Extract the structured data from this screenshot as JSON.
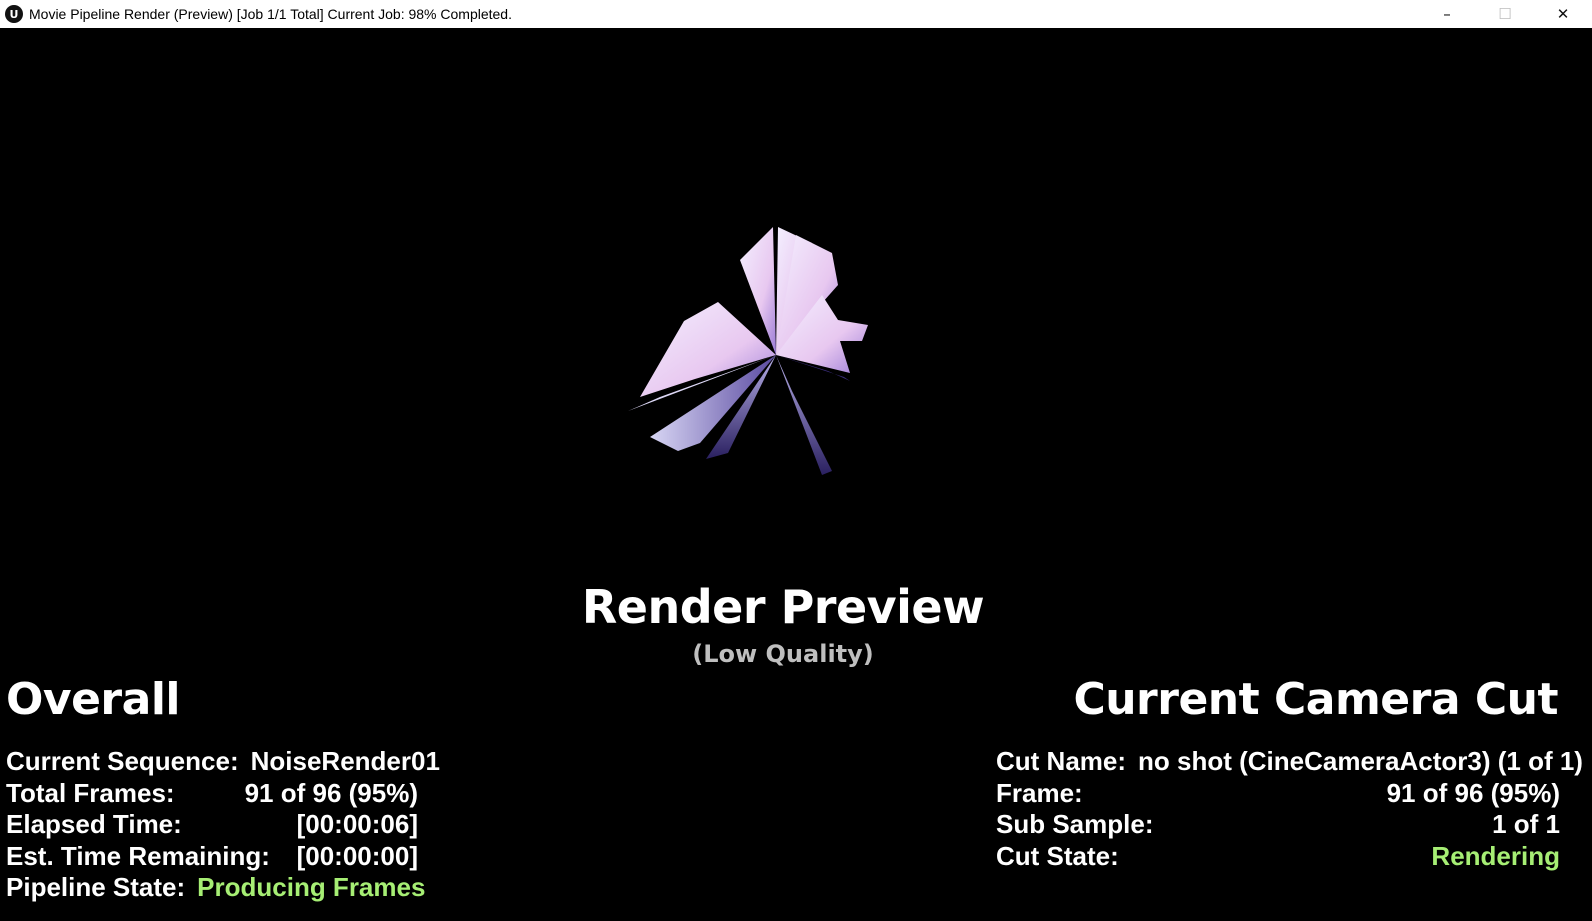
{
  "window": {
    "title": "Movie Pipeline Render (Preview) [Job 1/1 Total] Current Job: 98% Completed.",
    "app_icon": "unreal-logo-icon",
    "controls": {
      "minimize": "–",
      "maximize": "☐",
      "close": "✕"
    }
  },
  "preview": {
    "title": "Render Preview",
    "subtitle": "(Low Quality)"
  },
  "overall": {
    "heading": "Overall",
    "rows": [
      {
        "label": "Current Sequence:",
        "value": "NoiseRender01"
      },
      {
        "label": "Total Frames:",
        "value": "91 of 96 (95%)"
      },
      {
        "label": "Elapsed Time:",
        "value": "[00:00:06]"
      },
      {
        "label": "Est. Time Remaining:",
        "value": "[00:00:00]"
      },
      {
        "label": "Pipeline State:",
        "value": "Producing Frames"
      }
    ]
  },
  "camera_cut": {
    "heading": "Current Camera Cut",
    "rows": [
      {
        "label": "Cut Name:",
        "value": "no shot (CineCameraActor3) (1 of 1)"
      },
      {
        "label": "Frame:",
        "value": "91 of 96 (95%)"
      },
      {
        "label": "Sub Sample:",
        "value": "1 of 1"
      },
      {
        "label": "Cut State:",
        "value": "Rendering"
      }
    ]
  },
  "colors": {
    "background": "#000000",
    "text": "#ffffff",
    "subtitle": "#bfbfbf",
    "state_accent": "#a6ee74"
  }
}
